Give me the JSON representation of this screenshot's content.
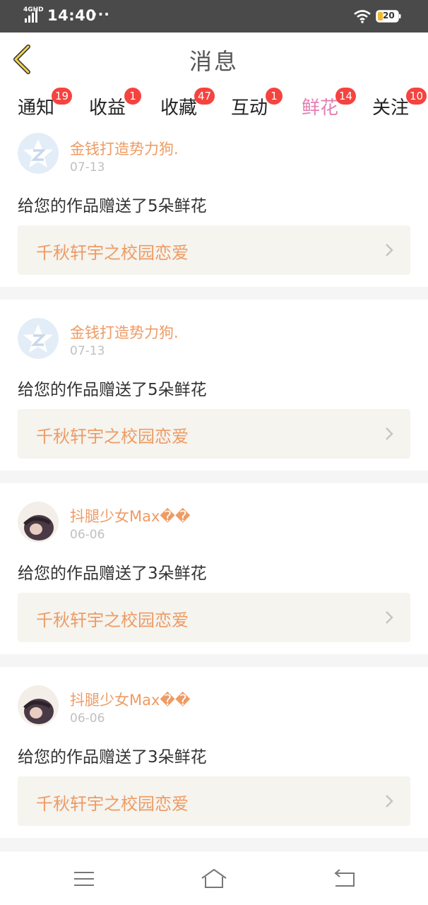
{
  "status_bar": {
    "network": "4GHD",
    "time": "14:40",
    "dots": "···",
    "battery": "20"
  },
  "header": {
    "title": "消息"
  },
  "tabs": [
    {
      "label": "通知",
      "badge": "19",
      "active": false
    },
    {
      "label": "收益",
      "badge": "1",
      "active": false
    },
    {
      "label": "收藏",
      "badge": "47",
      "active": false
    },
    {
      "label": "互动",
      "badge": "1",
      "active": false
    },
    {
      "label": "鲜花",
      "badge": "14",
      "active": true
    },
    {
      "label": "关注",
      "badge": "10",
      "active": false
    }
  ],
  "items": [
    {
      "avatar": "default-avatar-icon",
      "username": "金钱打造势力狗.",
      "date": "07-13",
      "message": "给您的作品赠送了5朵鲜花",
      "work_title": "千秋轩宇之校园恋爱"
    },
    {
      "avatar": "default-avatar-icon",
      "username": "金钱打造势力狗.",
      "date": "07-13",
      "message": "给您的作品赠送了5朵鲜花",
      "work_title": "千秋轩宇之校园恋爱"
    },
    {
      "avatar": "user-photo",
      "username": "抖腿少女Max��",
      "date": "06-06",
      "message": "给您的作品赠送了3朵鲜花",
      "work_title": "千秋轩宇之校园恋爱"
    },
    {
      "avatar": "user-photo",
      "username": "抖腿少女Max��",
      "date": "06-06",
      "message": "给您的作品赠送了3朵鲜花",
      "work_title": "千秋轩宇之校园恋爱"
    }
  ],
  "nav": {
    "menu": "menu-icon",
    "home": "home-icon",
    "back": "back-icon"
  },
  "colors": {
    "accent": "#e37fb3",
    "username": "#ee9b64",
    "badge": "#f5433f",
    "card_bg": "#f5f4ef"
  }
}
